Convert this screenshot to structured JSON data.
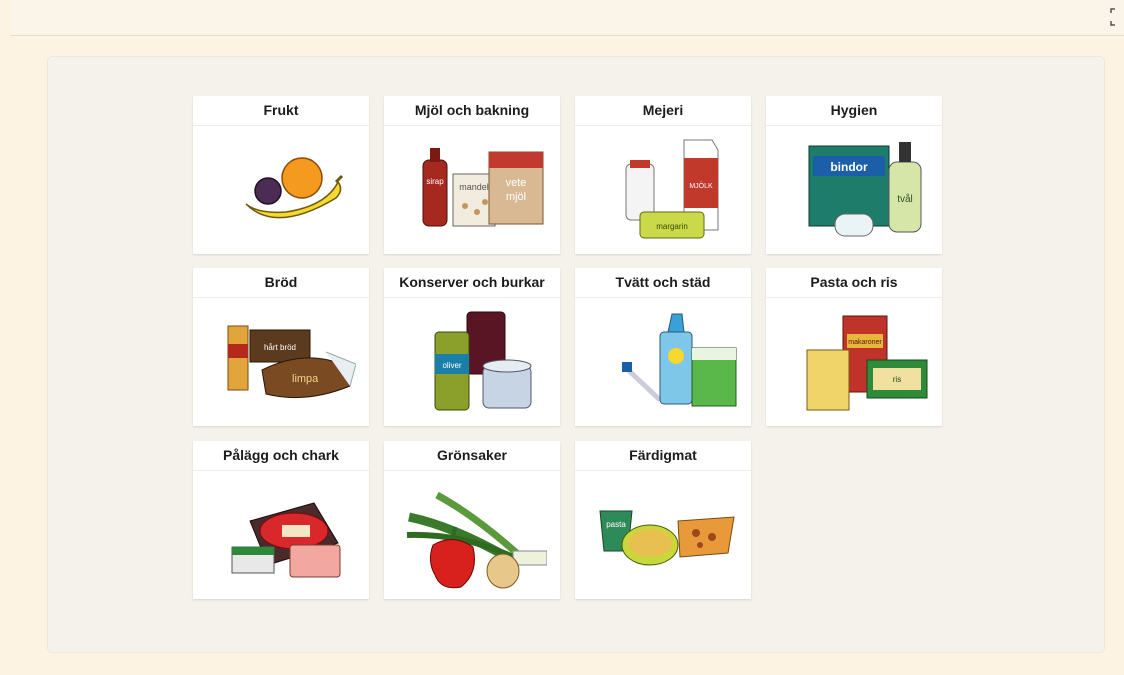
{
  "categories": [
    {
      "label": "Frukt",
      "icon": "fruit-icon"
    },
    {
      "label": "Mjöl och bakning",
      "icon": "baking-icon",
      "img_text": [
        "sirap",
        "mandel",
        "vete",
        "mjöl"
      ]
    },
    {
      "label": "Mejeri",
      "icon": "dairy-icon",
      "img_text": [
        "MJÖLK",
        "margarin"
      ]
    },
    {
      "label": "Hygien",
      "icon": "hygiene-icon",
      "img_text": [
        "bindor",
        "tvål"
      ]
    },
    {
      "label": "Bröd",
      "icon": "bread-icon",
      "img_text": [
        "limpa",
        "hårt bröd"
      ]
    },
    {
      "label": "Konserver och burkar",
      "icon": "cans-icon",
      "img_text": [
        "oliver"
      ]
    },
    {
      "label": "Tvätt och städ",
      "icon": "cleaning-icon"
    },
    {
      "label": "Pasta och ris",
      "icon": "pasta-icon",
      "img_text": [
        "makaroner",
        "ris"
      ]
    },
    {
      "label": "Pålägg och chark",
      "icon": "deli-icon"
    },
    {
      "label": "Grönsaker",
      "icon": "vegetables-icon"
    },
    {
      "label": "Färdigmat",
      "icon": "ready-meal-icon",
      "img_text": [
        "pasta"
      ]
    }
  ],
  "colors": {
    "page_bg": "#fdf3e3",
    "panel_bg": "#f5f2ec",
    "card_bg": "#ffffff",
    "title_text": "#1c1c1c"
  }
}
